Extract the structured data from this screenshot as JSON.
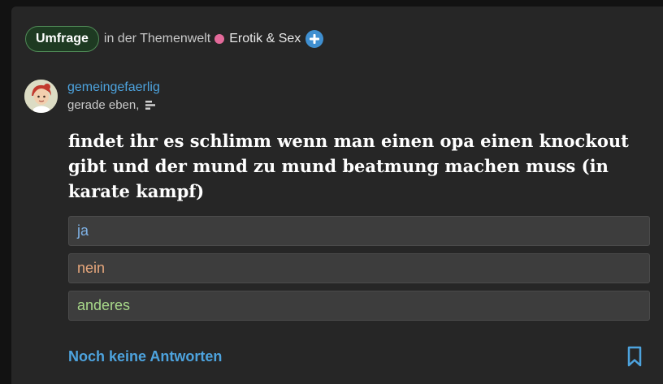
{
  "post": {
    "badge_label": "Umfrage",
    "in_text": "in der Themenwelt",
    "topic_name": "Erotik & Sex",
    "topic_dot_color": "#e36a9a",
    "plus_icon": "plus-circle-icon",
    "plus_color": "#3f8fd0"
  },
  "author": {
    "name": "gemeingefaerlig",
    "time": "gerade eben,",
    "stats_icon": "bar-chart-icon",
    "avatar": "cartoon-avatar"
  },
  "question": "findet ihr es schlimm wenn man einen opa einen knockout gibt und der mund zu mund beatmung machen muss (in karate kampf)",
  "options": [
    {
      "label": "ja",
      "color": "#7fb2e6"
    },
    {
      "label": "nein",
      "color": "#e7a77c"
    },
    {
      "label": "anderes",
      "color": "#a8d98a"
    }
  ],
  "footer": {
    "answers_text": "Noch keine Antworten",
    "bookmark_icon": "bookmark-icon"
  }
}
